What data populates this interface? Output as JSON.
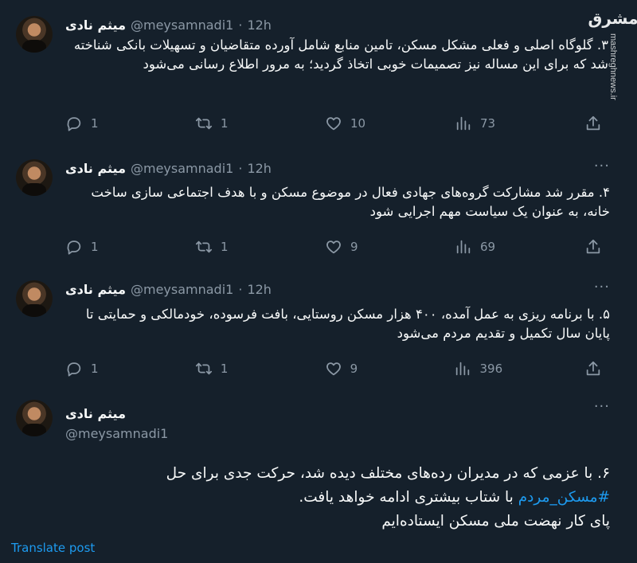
{
  "watermark": {
    "logo_text": "مشرق",
    "url": "mashreghnews.ir"
  },
  "tweets": [
    {
      "author": "میثم نادی",
      "handle": "@meysamnadi1",
      "dot": "·",
      "time": "12h",
      "text": "۳. گلوگاه اصلی و فعلی مشکل مسکن، تامین منابع شامل آورده متقاضیان و تسهیلات بانکی شناخته شد که برای این مساله نیز تصمیمات خوبی اتخاذ گردید؛ به مرور اطلاع رسانی می‌شود",
      "replies": "1",
      "reposts": "1",
      "likes": "10",
      "views": "73"
    },
    {
      "author": "میثم نادی",
      "handle": "@meysamnadi1",
      "dot": "·",
      "time": "12h",
      "more": "···",
      "text": "۴. مقرر شد مشارکت گروه‌های جهادی فعال در موضوع مسکن و با هدف اجتماعی سازی ساخت خانه، به عنوان یک سیاست مهم اجرایی شود",
      "replies": "1",
      "reposts": "1",
      "likes": "9",
      "views": "69"
    },
    {
      "author": "میثم نادی",
      "handle": "@meysamnadi1",
      "dot": "·",
      "time": "12h",
      "more": "···",
      "text": "۵. با برنامه ریزی به عمل آمده، ۴۰۰ هزار مسکن روستایی، بافت فرسوده، خودمالکی و حمایتی تا پایان سال تکمیل و تقدیم مردم می‌شود",
      "replies": "1",
      "reposts": "1",
      "likes": "9",
      "views": "396"
    }
  ],
  "focal": {
    "author": "میثم نادی",
    "handle": "@meysamnadi1",
    "more": "···",
    "text_part1": "۶. با عزمی که در مدیران رده‌های مختلف دیده شد، حرکت جدی برای حل",
    "hashtag": "#مسکن_مردم",
    "text_part2": "با شتاب بیشتری ادامه خواهد یافت.",
    "text_part3": "پای کار نهضت ملی مسکن ایستاده‌ایم",
    "translate_label": "Translate post"
  },
  "icons": {
    "reply": "reply-bubble-icon",
    "repost": "repost-arrows-icon",
    "like": "heart-icon",
    "views": "bar-chart-icon",
    "share": "share-upload-icon",
    "more": "more-dots-icon"
  },
  "colors": {
    "background": "#15202b",
    "text": "#f7f9f9",
    "muted": "#8b98a5",
    "accent": "#1d9bf0"
  }
}
